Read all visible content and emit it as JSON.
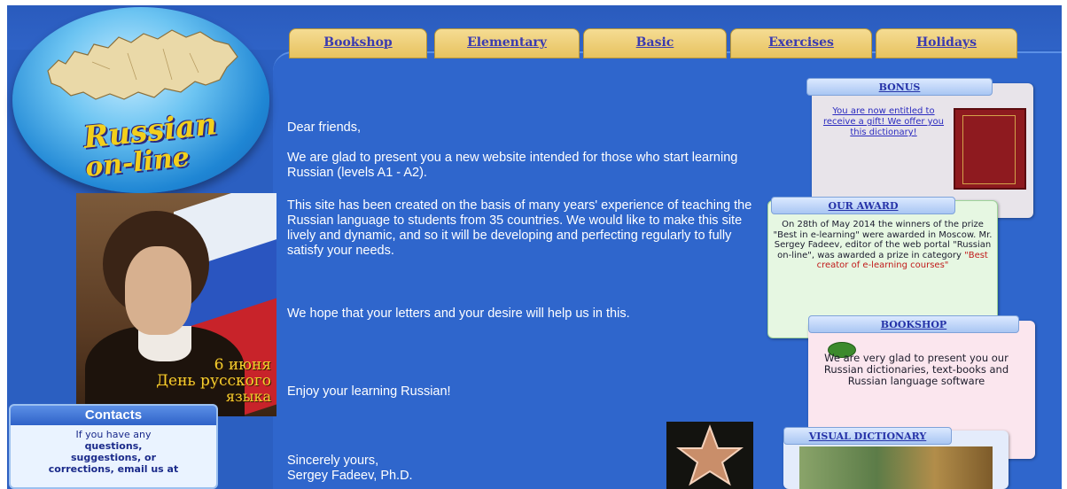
{
  "logo": {
    "line1": "Russian",
    "line2": "on-line"
  },
  "nav": {
    "tabs": [
      {
        "label": "Bookshop"
      },
      {
        "label": "Elementary"
      },
      {
        "label": "Basic"
      },
      {
        "label": "Exercises"
      },
      {
        "label": "Holidays"
      }
    ]
  },
  "poster": {
    "line1": "6 июня",
    "line2": "День русского",
    "line3": "языка"
  },
  "contacts": {
    "title": "Contacts",
    "line1": "If you have any",
    "line2": "questions,",
    "line3": "suggestions, or",
    "line4": "corrections, email us at"
  },
  "main": {
    "greeting": "Dear friends,",
    "p1": "We are glad to present you a new website intended for those who start learning Russian (levels A1 - A2).",
    "p2": "This site has been created on the basis of many years' experience of teaching the Russian language to students from 35 countries. We would like to make this site lively and dynamic, and so it will be developing and perfecting regularly to fully satisfy your needs.",
    "p3": "We hope that your letters and your desire will help us in this.",
    "p4": "Enjoy your learning Russian!",
    "closing": "Sincerely yours,",
    "signature": "Sergey Fadeev, Ph.D."
  },
  "bonus": {
    "title": "BONUS",
    "text": "You are now entitled to receive a gift! We offer you this dictionary!"
  },
  "award": {
    "title": "OUR AWARD",
    "text": "On 28th of May 2014 the winners of the prize \"Best in e-learning\" were awarded in Moscow. Mr. Sergey Fadeev, editor of the web portal \"Russian on-line\", was awarded a prize in category",
    "highlight": "\"Best creator of e-learning courses\""
  },
  "bookshop": {
    "title": "BOOKSHOP",
    "text": "We are very glad to present you our Russian dictionaries, text-books and Russian language software"
  },
  "visual_dictionary": {
    "title": "VISUAL DICTIONARY"
  },
  "colors": {
    "background": "#2b5fc1",
    "tab": "#e7c25f",
    "tab_text": "#3b3bb0",
    "logo_text": "#f2cf1c",
    "award_highlight": "#c01a1a"
  }
}
